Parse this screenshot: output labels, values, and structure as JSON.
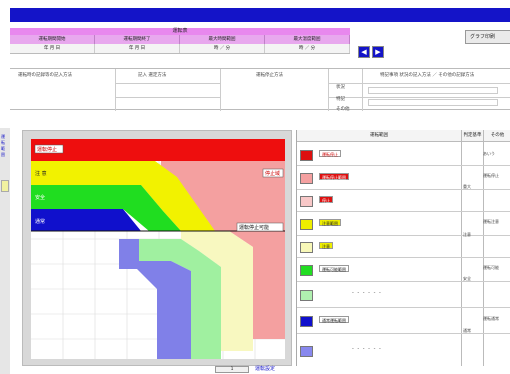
{
  "window": {
    "title_color": "#1414c8"
  },
  "header": {
    "title": "運転表",
    "columns": [
      "運転期間開始",
      "運転期間終了",
      "最大時間範囲",
      "最大温度範囲"
    ],
    "values": [
      "年 月 日",
      "年 月 日",
      "時 ／ 分",
      "時 ／ 分"
    ],
    "prev_icon": "prev-arrow-icon",
    "next_icon": "next-arrow-icon",
    "graph_button_label": "グラフ印刷"
  },
  "info": {
    "label_left": "運転時の記録等の記入方法",
    "label_mid1": "記入 選定方法",
    "label_mid2": "運転停止方法",
    "label_right": "特記事項 状況の記入方法 ／ その他の記録方法",
    "row_labels": [
      "状況",
      "特記",
      "その他"
    ]
  },
  "left_strip": {
    "labels": [
      "運",
      "転",
      "範",
      "囲"
    ]
  },
  "chart": {
    "label_red": "運転停止",
    "label_yellow": "注 意",
    "label_green": "安全",
    "label_blue": "通常",
    "label_red_right": "停止域",
    "label_line": "運転停止可能"
  },
  "chart_data": {
    "type": "area",
    "title": "",
    "xlabel": "",
    "ylabel": "",
    "series": [
      {
        "color": "#e81010",
        "zone": "stop"
      },
      {
        "color": "#f2f200",
        "zone": "caution"
      },
      {
        "color": "#20dd20",
        "zone": "safe"
      },
      {
        "color": "#1010cc",
        "zone": "normal"
      }
    ],
    "grid": true
  },
  "legend": {
    "head": [
      "運転範囲",
      "判定基準",
      "その他"
    ],
    "rows": [
      {
        "color": "#dd1010",
        "label": "運転停止",
        "note": "",
        "col3": "あいう"
      },
      {
        "color": "#f4a0a0",
        "label": "運転停止範囲",
        "note": "",
        "col3": "運転停止"
      },
      {
        "color": "#f8c8c8",
        "label": "停止",
        "note": "重大",
        "col3": ""
      },
      {
        "color": "#eeee00",
        "label": "注意範囲",
        "note": "",
        "col3": "運転注意"
      },
      {
        "color": "#f8f8b8",
        "label": "注意",
        "note": "注意",
        "col3": ""
      },
      {
        "color": "#22dd22",
        "label": "運転可能範囲",
        "note": "",
        "col3": "運転可能"
      },
      {
        "color": "#b0f0b0",
        "label": "",
        "note": "安全",
        "col3": ""
      },
      {
        "color": "#1010cc",
        "label": "通常運転範囲",
        "note": "",
        "col3": "運転通常"
      },
      {
        "color": "#8888ee",
        "label": "",
        "note": "通常",
        "col3": ""
      }
    ],
    "dashes": "- - - - - -"
  },
  "bottom": {
    "page": "1",
    "label": "運転設定"
  }
}
